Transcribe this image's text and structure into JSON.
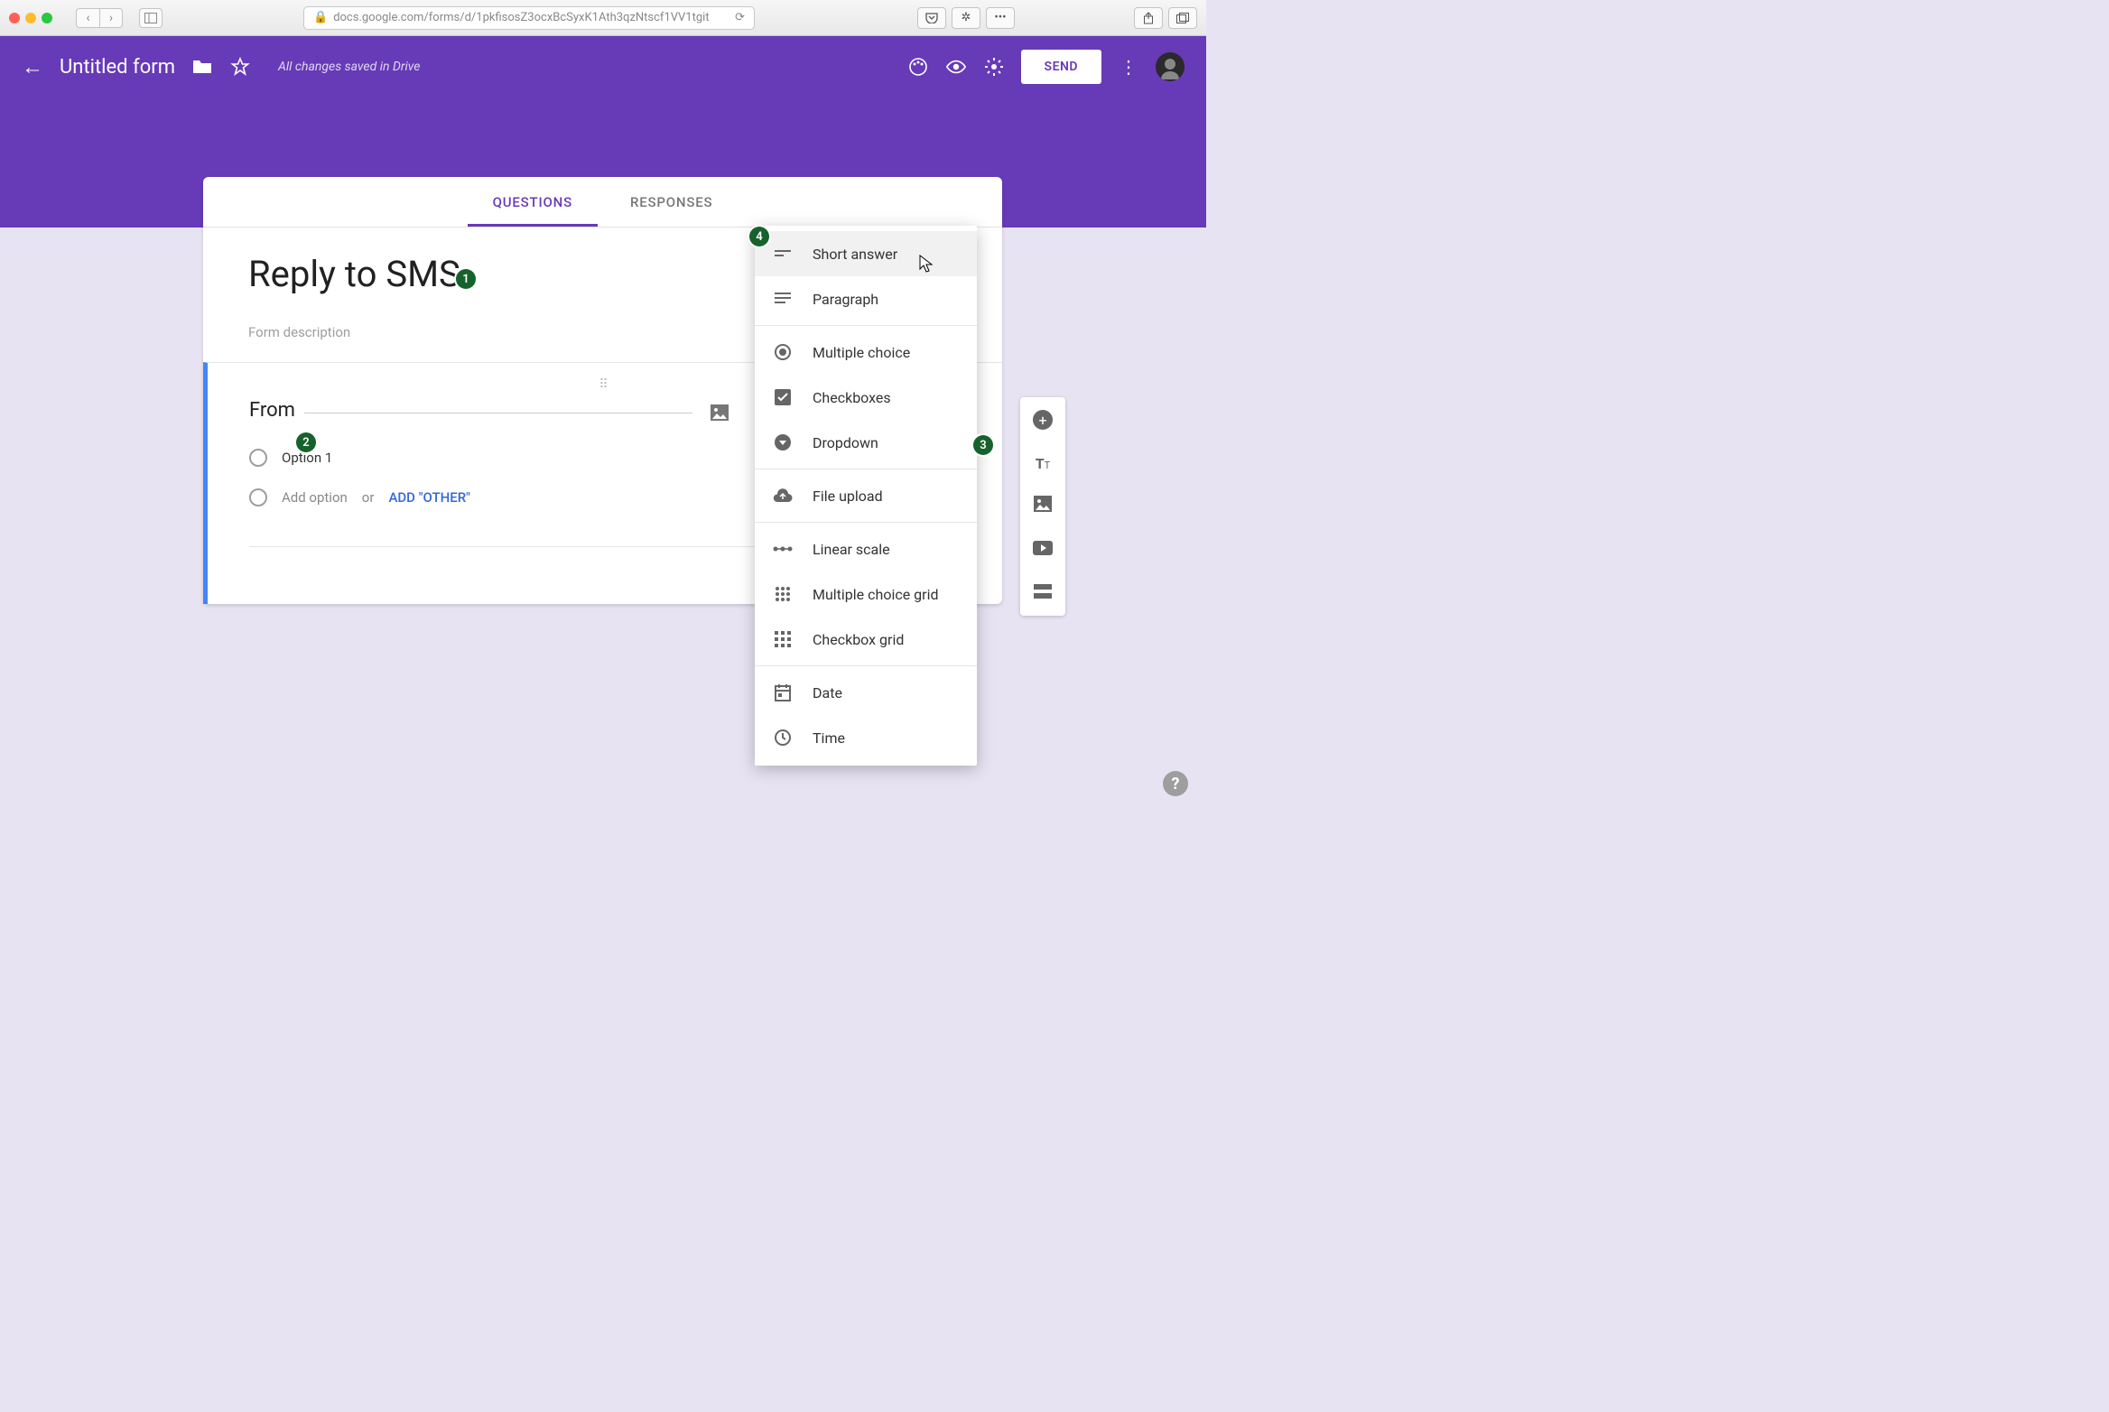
{
  "browser": {
    "url": "docs.google.com/forms/d/1pkfisosZ3ocxBcSyxK1Ath3qzNtscf1VV1tgit"
  },
  "header": {
    "doc_title": "Untitled form",
    "save_status": "All changes saved in Drive",
    "send_label": "SEND"
  },
  "tabs": {
    "questions": "QUESTIONS",
    "responses": "RESPONSES"
  },
  "form": {
    "title": "Reply to SMS",
    "description_placeholder": "Form description"
  },
  "question": {
    "title": "From",
    "option1": "Option 1",
    "add_option": "Add option",
    "or": "or",
    "add_other": "ADD \"OTHER\""
  },
  "type_menu": {
    "short_answer": "Short answer",
    "paragraph": "Paragraph",
    "multiple_choice": "Multiple choice",
    "checkboxes": "Checkboxes",
    "dropdown": "Dropdown",
    "file_upload": "File upload",
    "linear_scale": "Linear scale",
    "mc_grid": "Multiple choice grid",
    "cb_grid": "Checkbox grid",
    "date": "Date",
    "time": "Time"
  },
  "annotations": {
    "a1": "1",
    "a2": "2",
    "a3": "3",
    "a4": "4"
  }
}
